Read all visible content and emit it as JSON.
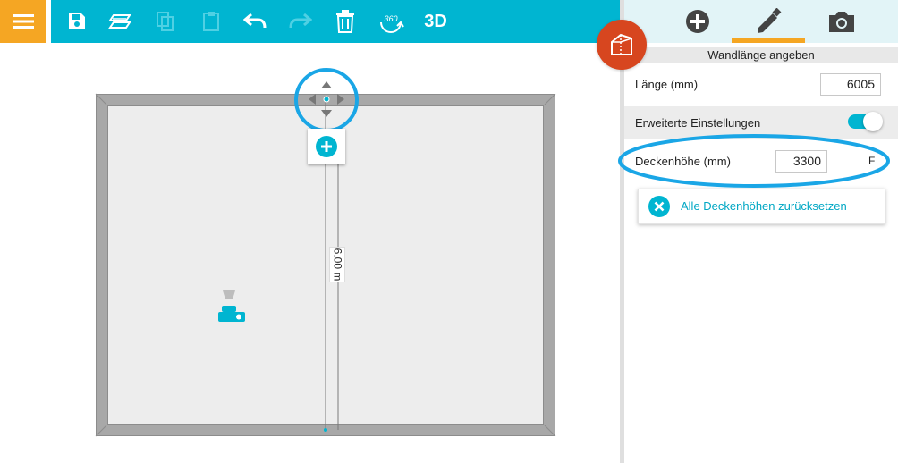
{
  "toolbar": {
    "menu_icon": "hamburger-menu-icon",
    "three_d_label": "3D",
    "view360_label": "360",
    "icons": [
      "save-icon",
      "floor-layer-icon",
      "copy-icon",
      "paste-icon",
      "undo-icon",
      "redo-icon",
      "trash-icon",
      "rotate-360-icon",
      "3d-view-button"
    ],
    "colors": {
      "bar": "#00b5d1",
      "menu": "#f5a623"
    }
  },
  "canvas": {
    "measurement_label": "6.00 m",
    "icons": [
      "move-arrows-icon",
      "add-wall-icon",
      "projector-icon"
    ]
  },
  "panel": {
    "tab_icons": [
      "add-icon",
      "pencil-icon",
      "camera-icon"
    ],
    "active_tab": "pencil",
    "section_title": "Wandlänge angeben",
    "length": {
      "label": "Länge (mm)",
      "value": "6005"
    },
    "advanced": {
      "label": "Erweiterte Einstellungen",
      "enabled": true
    },
    "ceiling": {
      "label": "Deckenhöhe (mm)",
      "value": "3300",
      "suffix": "F"
    },
    "reset_label": "Alle Deckenhöhen zurücksetzen"
  },
  "badge": {
    "icon": "house-3d-icon",
    "color": "#d7461f"
  }
}
